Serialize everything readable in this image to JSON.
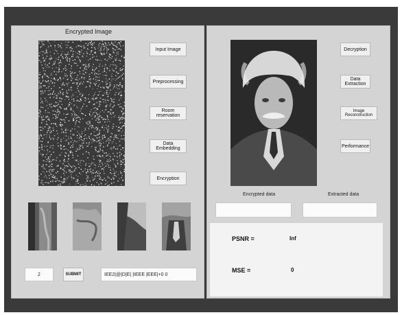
{
  "left_panel": {
    "title": "Encrypted Image",
    "buttons": {
      "input_image": "Input Image",
      "preprocessing": "Preprocessing",
      "room_reservation": "Room reservation",
      "data_embedding": "Data Embedding",
      "encryption": "Encryption"
    },
    "input_value": "2",
    "submit_label": "SUBMIT",
    "output_text": "IEE2|@|D|E|  |IEEE  |EEE|+0  0"
  },
  "right_panel": {
    "buttons": {
      "decryption": "Decryption",
      "data_extraction": "Data Extraction",
      "image_reconstruction": "Image Reconstruction",
      "performance": "Performance"
    },
    "encrypted_data_label": "Encrypted data",
    "extracted_data_label": "Extracted data",
    "encrypted_data_value": "",
    "extracted_data_value": "",
    "metrics": {
      "psnr_label": "PSNR =",
      "psnr_value": "Inf",
      "mse_label": "MSE =",
      "mse_value": "0"
    }
  }
}
